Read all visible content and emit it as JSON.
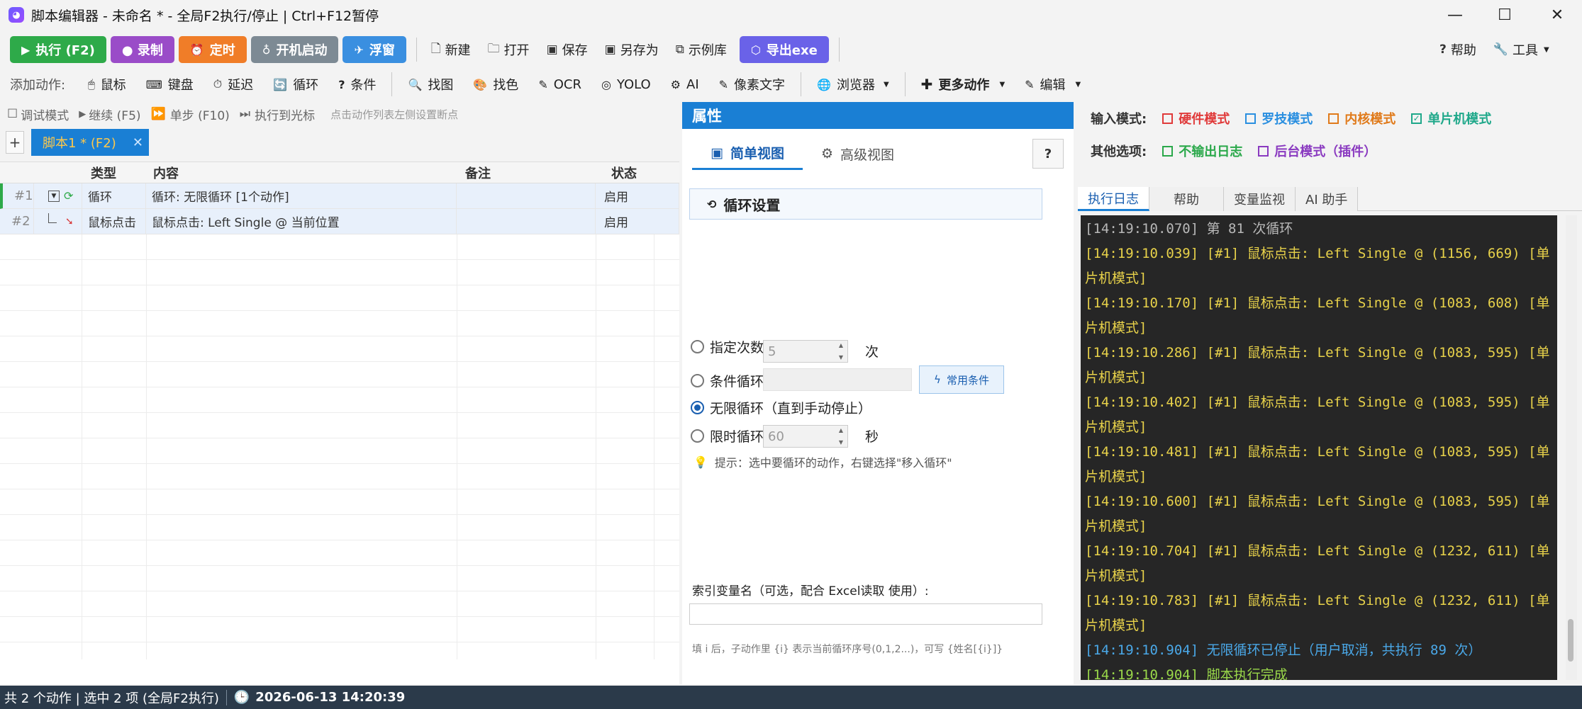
{
  "window": {
    "title": "脚本编辑器 - 未命名 * - 全局F2执行/停止 | Ctrl+F12暂停",
    "minimize": "—",
    "maximize": "☐",
    "close": "✕"
  },
  "toolbar": {
    "run": "执行 (F2)",
    "record": "● 录制",
    "schedule": "定时",
    "startup": "开机启动",
    "float": "浮窗",
    "new": "新建",
    "open": "打开",
    "save": "保存",
    "save_as": "另存为",
    "examples": "示例库",
    "export": "导出exe",
    "help": "帮助",
    "tools": "工具"
  },
  "actions": {
    "label": "添加动作:",
    "items": [
      "鼠标",
      "键盘",
      "延迟",
      "循环",
      "条件",
      "找图",
      "找色",
      "OCR",
      "YOLO",
      "AI",
      "像素文字",
      "浏览器"
    ],
    "more": "更多动作",
    "edit": "编辑"
  },
  "debug": {
    "debug_mode": "调试模式",
    "continue": "继续 (F5)",
    "step": "单步 (F10)",
    "run_to_cursor": "执行到光标",
    "hint": "点击动作列表左侧设置断点"
  },
  "script_tab": {
    "add": "+",
    "name": "脚本1 * (F2)",
    "close": "✕"
  },
  "table": {
    "headers": {
      "type": "类型",
      "content": "内容",
      "note": "备注",
      "status": "状态"
    },
    "rows": [
      {
        "num": "#1",
        "type": "循环",
        "content": "循环: 无限循环 [1个动作]",
        "note": "",
        "status": "启用"
      },
      {
        "num": "#2",
        "type": "鼠标点击",
        "content": "鼠标点击: Left Single @ 当前位置",
        "note": "",
        "status": "启用"
      }
    ]
  },
  "properties": {
    "title": "属性",
    "simple_view": "简单视图",
    "advanced_view": "高级视图",
    "help_btn": "?",
    "section": "循环设置",
    "opt_count": "指定次数",
    "count_value": "5",
    "count_unit": "次",
    "opt_condition": "条件循环",
    "common_conditions": "常用条件",
    "opt_infinite": "无限循环（直到手动停止）",
    "opt_timed": "限时循环",
    "timed_value": "60",
    "timed_unit": "秒",
    "hint": "提示：选中要循环的动作，右键选择\"移入循环\"",
    "index_label": "索引变量名（可选，配合 Excel读取 使用）:",
    "index_hint": "填 i 后，子动作里 {i} 表示当前循环序号(0,1,2...)，可写 {姓名[{i}]}"
  },
  "input_mode": {
    "label": "输入模式:",
    "options": [
      {
        "label": "硬件模式",
        "checked": false,
        "color": "#e03a3a"
      },
      {
        "label": "罗技模式",
        "checked": false,
        "color": "#2a8fe0"
      },
      {
        "label": "内核模式",
        "checked": false,
        "color": "#e07a1a"
      },
      {
        "label": "单片机模式",
        "checked": true,
        "color": "#1fa88a"
      }
    ]
  },
  "other_options": {
    "label": "其他选项:",
    "options": [
      {
        "label": "不输出日志",
        "checked": false,
        "color": "#2aa84a"
      },
      {
        "label": "后台模式（插件）",
        "checked": false,
        "color": "#8a3ac0"
      }
    ]
  },
  "log_tabs": [
    "执行日志",
    "帮助",
    "变量监视",
    "AI 助手"
  ],
  "log": [
    {
      "text": "[14:19:10.070]     第 81 次循环",
      "color": "#b8b8b8"
    },
    {
      "text": "  [14:19:10.039] [#1] 鼠标点击: Left Single @ (1156, 669) [单",
      "color": "#e8d24a"
    },
    {
      "text": "片机模式]",
      "color": "#e8d24a"
    },
    {
      "text": "  [14:19:10.170] [#1] 鼠标点击: Left Single @ (1083, 608) [单",
      "color": "#e8d24a"
    },
    {
      "text": "片机模式]",
      "color": "#e8d24a"
    },
    {
      "text": "  [14:19:10.286] [#1] 鼠标点击: Left Single @ (1083, 595) [单",
      "color": "#e8d24a"
    },
    {
      "text": "片机模式]",
      "color": "#e8d24a"
    },
    {
      "text": "  [14:19:10.402] [#1] 鼠标点击: Left Single @ (1083, 595) [单",
      "color": "#e8d24a"
    },
    {
      "text": "片机模式]",
      "color": "#e8d24a"
    },
    {
      "text": "  [14:19:10.481] [#1] 鼠标点击: Left Single @ (1083, 595) [单",
      "color": "#e8d24a"
    },
    {
      "text": "片机模式]",
      "color": "#e8d24a"
    },
    {
      "text": "  [14:19:10.600] [#1] 鼠标点击: Left Single @ (1083, 595) [单",
      "color": "#e8d24a"
    },
    {
      "text": "片机模式]",
      "color": "#e8d24a"
    },
    {
      "text": "  [14:19:10.704] [#1] 鼠标点击: Left Single @ (1232, 611) [单",
      "color": "#e8d24a"
    },
    {
      "text": "片机模式]",
      "color": "#e8d24a"
    },
    {
      "text": "  [14:19:10.783] [#1] 鼠标点击: Left Single @ (1232, 611) [单",
      "color": "#e8d24a"
    },
    {
      "text": "片机模式]",
      "color": "#e8d24a"
    },
    {
      "text": "[14:19:10.904]   无限循环已停止（用户取消，共执行 89 次）",
      "color": "#4aa8e8"
    },
    {
      "text": "[14:19:10.904] 脚本执行完成",
      "color": "#9ad84a"
    }
  ],
  "status": {
    "summary": "共 2 个动作 | 选中 2 项 (全局F2执行)",
    "datetime": "2026-06-13 14:20:39"
  }
}
